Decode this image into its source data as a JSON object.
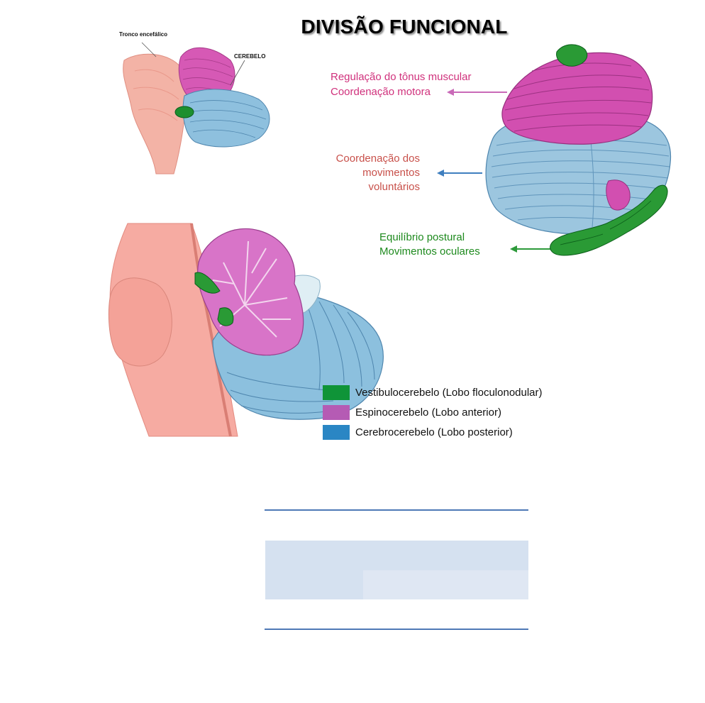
{
  "title": "DIVISÃO FUNCIONAL",
  "small_figure": {
    "label_brainstem": "Tronco encefálico",
    "label_cerebellum": "CEREBELO"
  },
  "functions": {
    "spino": [
      "Regulação do tônus muscular",
      "Coordenação motora"
    ],
    "cerebro": [
      "Coordenação dos",
      "movimentos",
      "voluntários"
    ],
    "vestibulo": [
      "Equilíbrio postural",
      "Movimentos oculares"
    ]
  },
  "legend": [
    {
      "label": "Vestibulocerebelo (Lobo floculonodular)",
      "color": "#0f9438"
    },
    {
      "label": "Espinocerebelo (Lobo anterior)",
      "color": "#b55bb4"
    },
    {
      "label": "Cerebrocerebelo (Lobo posterior)",
      "color": "#2a86c4"
    }
  ],
  "colors": {
    "pink_label": "#d0317c",
    "red_label": "#c8504a",
    "green_label": "#1e8a1e",
    "blue_arrow": "#3f7fbf",
    "table_line": "#4e79b6",
    "table_band": "#d5e1f0",
    "table_band_light": "#dfe7f3"
  }
}
